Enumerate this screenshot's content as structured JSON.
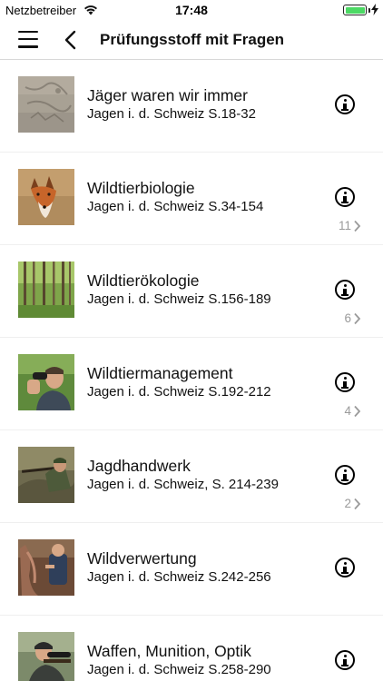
{
  "status_bar": {
    "carrier": "Netzbetreiber",
    "time": "17:48",
    "battery_color": "#4cd964"
  },
  "nav": {
    "menu_icon": "hamburger-icon",
    "back_icon": "chevron-left-icon",
    "title": "Prüfungsstoff mit Fragen"
  },
  "rows": [
    {
      "title": "Jäger waren wir immer",
      "subtitle": "Jagen i. d. Schweiz S.18-32",
      "count": "",
      "image": "rock-carving"
    },
    {
      "title": "Wildtierbiologie",
      "subtitle": "Jagen i. d. Schweiz S.34-154",
      "count": "11",
      "image": "fox"
    },
    {
      "title": "Wildtierökologie",
      "subtitle": "Jagen i. d. Schweiz S.156-189",
      "count": "6",
      "image": "forest"
    },
    {
      "title": "Wildtiermanagement",
      "subtitle": "Jagen i. d. Schweiz S.192-212",
      "count": "4",
      "image": "man-with-binoculars"
    },
    {
      "title": "Jagdhandwerk",
      "subtitle": "Jagen i. d. Schweiz, S. 214-239",
      "count": "2",
      "image": "hunter-aiming"
    },
    {
      "title": "Wildverwertung",
      "subtitle": "Jagen i. d. Schweiz S.242-256",
      "count": "",
      "image": "game-processing"
    },
    {
      "title": "Waffen, Munition, Optik",
      "subtitle": "Jagen i. d. Schweiz S.258-290",
      "count": "",
      "image": "man-with-scope"
    }
  ]
}
